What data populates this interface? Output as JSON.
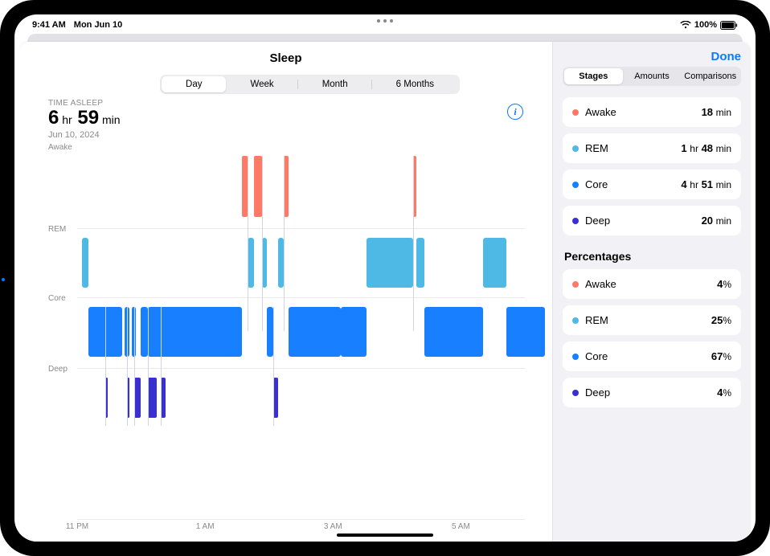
{
  "status": {
    "time": "9:41 AM",
    "date": "Mon Jun 10",
    "battery": "100%"
  },
  "nav": {
    "title": "Sleep",
    "done": "Done"
  },
  "range_tabs": [
    "Day",
    "Week",
    "Month",
    "6 Months"
  ],
  "range_active": 0,
  "summary": {
    "label": "TIME ASLEEP",
    "hours": "6",
    "hours_unit": "hr",
    "minutes": "59",
    "minutes_unit": "min",
    "date": "Jun 10, 2024"
  },
  "side_tabs": [
    "Stages",
    "Amounts",
    "Comparisons"
  ],
  "side_active": 0,
  "stages_list": [
    {
      "name": "Awake",
      "color": "#ff7a66",
      "value_html": "<b>18</b> <span class='u'>min</span>"
    },
    {
      "name": "REM",
      "color": "#4fb9e6",
      "value_html": "<b>1</b> <span class='u'>hr</span> <b>48</b> <span class='u'>min</span>"
    },
    {
      "name": "Core",
      "color": "#1880ff",
      "value_html": "<b>4</b> <span class='u'>hr</span> <b>51</b> <span class='u'>min</span>"
    },
    {
      "name": "Deep",
      "color": "#3a2fd0",
      "value_html": "<b>20</b> <span class='u'>min</span>"
    }
  ],
  "percentages_title": "Percentages",
  "percentages_list": [
    {
      "name": "Awake",
      "color": "#ff7a66",
      "value_html": "<b>4</b><span class='u'>%</span>"
    },
    {
      "name": "REM",
      "color": "#4fb9e6",
      "value_html": "<b>25</b><span class='u'>%</span>"
    },
    {
      "name": "Core",
      "color": "#1880ff",
      "value_html": "<b>67</b><span class='u'>%</span>"
    },
    {
      "name": "Deep",
      "color": "#3a2fd0",
      "value_html": "<b>4</b><span class='u'>%</span>"
    }
  ],
  "chart_data": {
    "type": "sleep-stages-timeline",
    "x_start_minutes": 0,
    "x_end_minutes": 420,
    "x_ticks": [
      {
        "label": "11 PM",
        "minutes": 0
      },
      {
        "label": "1 AM",
        "minutes": 120
      },
      {
        "label": "3 AM",
        "minutes": 240
      },
      {
        "label": "5 AM",
        "minutes": 360
      }
    ],
    "stages": [
      "Awake",
      "REM",
      "Core",
      "Deep"
    ],
    "stage_colors": {
      "Awake": "#ff7a66",
      "REM": "#4fb9e6",
      "Core": "#1880ff",
      "Deep": "#3a2fd0"
    },
    "intervals": [
      {
        "stage": "REM",
        "start": 4,
        "end": 10
      },
      {
        "stage": "Core",
        "start": 10,
        "end": 40
      },
      {
        "stage": "Deep",
        "start": 25,
        "end": 27
      },
      {
        "stage": "Core",
        "start": 42,
        "end": 46
      },
      {
        "stage": "Deep",
        "start": 44,
        "end": 46
      },
      {
        "stage": "Core",
        "start": 48,
        "end": 52
      },
      {
        "stage": "Deep",
        "start": 50,
        "end": 56
      },
      {
        "stage": "Core",
        "start": 56,
        "end": 62
      },
      {
        "stage": "Deep",
        "start": 62,
        "end": 70
      },
      {
        "stage": "Core",
        "start": 62,
        "end": 145
      },
      {
        "stage": "Deep",
        "start": 74,
        "end": 78
      },
      {
        "stage": "Awake",
        "start": 145,
        "end": 150
      },
      {
        "stage": "REM",
        "start": 150,
        "end": 156
      },
      {
        "stage": "Awake",
        "start": 156,
        "end": 163
      },
      {
        "stage": "REM",
        "start": 163,
        "end": 167
      },
      {
        "stage": "Core",
        "start": 167,
        "end": 173
      },
      {
        "stage": "Deep",
        "start": 173,
        "end": 177
      },
      {
        "stage": "REM",
        "start": 177,
        "end": 182
      },
      {
        "stage": "Awake",
        "start": 182,
        "end": 186
      },
      {
        "stage": "Core",
        "start": 186,
        "end": 232
      },
      {
        "stage": "REM",
        "start": 255,
        "end": 296
      },
      {
        "stage": "Core",
        "start": 232,
        "end": 255
      },
      {
        "stage": "Awake",
        "start": 296,
        "end": 299
      },
      {
        "stage": "REM",
        "start": 299,
        "end": 306
      },
      {
        "stage": "Core",
        "start": 306,
        "end": 358
      },
      {
        "stage": "REM",
        "start": 358,
        "end": 378
      },
      {
        "stage": "Core",
        "start": 378,
        "end": 412
      }
    ]
  }
}
